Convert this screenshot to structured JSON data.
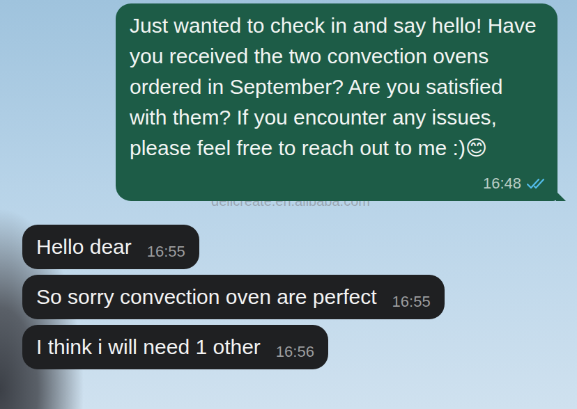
{
  "chat": {
    "watermark": "delicreate.en.alibaba.com"
  },
  "messages": [
    {
      "kind": "outgoing",
      "text": "Just wanted to check in and say hello! Have you received the two convection ovens ordered in September? Are you satisfied with them? If you encounter any issues, please feel free to reach out to me :)😊",
      "time": "16:48",
      "read": true
    },
    {
      "kind": "incoming",
      "text": "Hello dear",
      "time": "16:55"
    },
    {
      "kind": "incoming",
      "text": "So sorry convection oven are perfect",
      "time": "16:55"
    },
    {
      "kind": "incoming",
      "text": "I think i will need 1 other",
      "time": "16:56"
    }
  ]
}
